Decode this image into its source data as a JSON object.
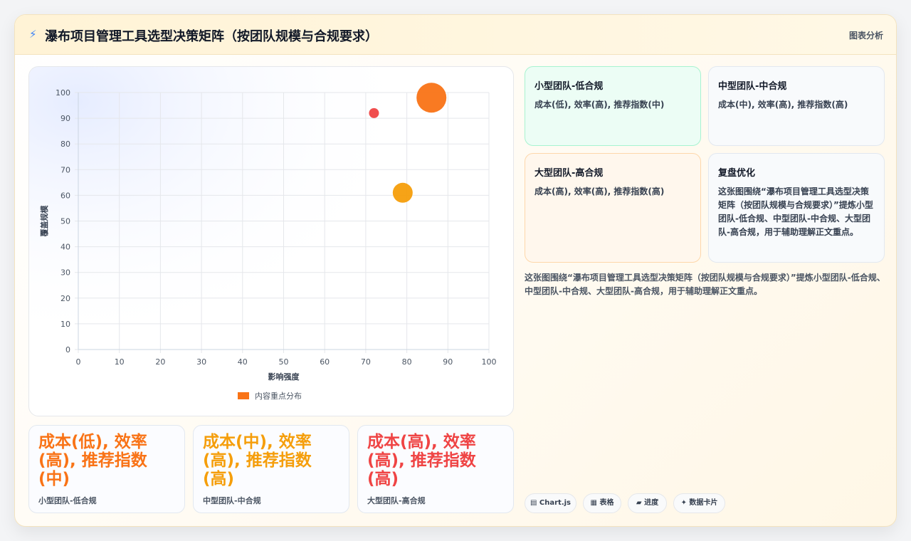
{
  "header": {
    "icon": "lightning-icon",
    "title": "瀑布项目管理工具选型决策矩阵（按团队规模与合规要求）",
    "tag": "图表分析"
  },
  "chart_data": {
    "type": "scatter",
    "xlabel": "影响强度",
    "ylabel": "覆盖规模",
    "xlim": [
      0,
      100
    ],
    "ylim": [
      0,
      100
    ],
    "xticks": [
      "0",
      "10",
      "20",
      "30",
      "40",
      "50",
      "60",
      "70",
      "80",
      "90",
      "100"
    ],
    "yticks": [
      "0",
      "10",
      "20",
      "30",
      "40",
      "50",
      "60",
      "70",
      "80",
      "90",
      "100"
    ],
    "grid": true,
    "legend": {
      "label": "内容重点分布",
      "placement": "bottom",
      "color": "#f97316"
    },
    "points": [
      {
        "x": 86,
        "y": 98,
        "r": 21,
        "color": "#f97316"
      },
      {
        "x": 72,
        "y": 92,
        "r": 7,
        "color": "#ef4444"
      },
      {
        "x": 79,
        "y": 61,
        "r": 14,
        "color": "#f59e0b"
      }
    ]
  },
  "stats": [
    {
      "value": "成本(低), 效率(高), 推荐指数(中)",
      "label": "小型团队-低合规",
      "color": "#f97316"
    },
    {
      "value": "成本(中), 效率(高), 推荐指数(高)",
      "label": "中型团队-中合规",
      "color": "#f59e0b"
    },
    {
      "value": "成本(高), 效率(高), 推荐指数(高)",
      "label": "大型团队-高合规",
      "color": "#ef4444"
    }
  ],
  "cards": [
    {
      "title": "小型团队-低合规",
      "desc": "成本(低), 效率(高), 推荐指数(中)",
      "bg": "#ecfdf5",
      "border": "#a7f3d0"
    },
    {
      "title": "中型团队-中合规",
      "desc": "成本(中), 效率(高), 推荐指数(高)",
      "bg": "#f8fafc",
      "border": "#e2e8f0"
    },
    {
      "title": "大型团队-高合规",
      "desc": "成本(高), 效率(高), 推荐指数(高)",
      "bg": "#fff7ed",
      "border": "#fed7aa"
    },
    {
      "title": "复盘优化",
      "desc": "这张图围绕“瀑布项目管理工具选型决策矩阵（按团队规模与合规要求）”提炼小型团队-低合规、中型团队-中合规、大型团队-高合规，用于辅助理解正文重点。",
      "bg": "#f8fafc",
      "border": "#e2e8f0"
    }
  ],
  "description": "这张图围绕“瀑布项目管理工具选型决策矩阵（按团队规模与合规要求）”提炼小型团队-低合规、中型团队-中合规、大型团队-高合规，用于辅助理解正文重点。",
  "chips": [
    {
      "label": "▤ Chart.js",
      "icon": "chart-icon"
    },
    {
      "label": "▦ 表格",
      "icon": "table-icon"
    },
    {
      "label": "▰ 进度",
      "icon": "progress-icon"
    },
    {
      "label": "✦ 数据卡片",
      "icon": "sparkle-icon"
    }
  ]
}
